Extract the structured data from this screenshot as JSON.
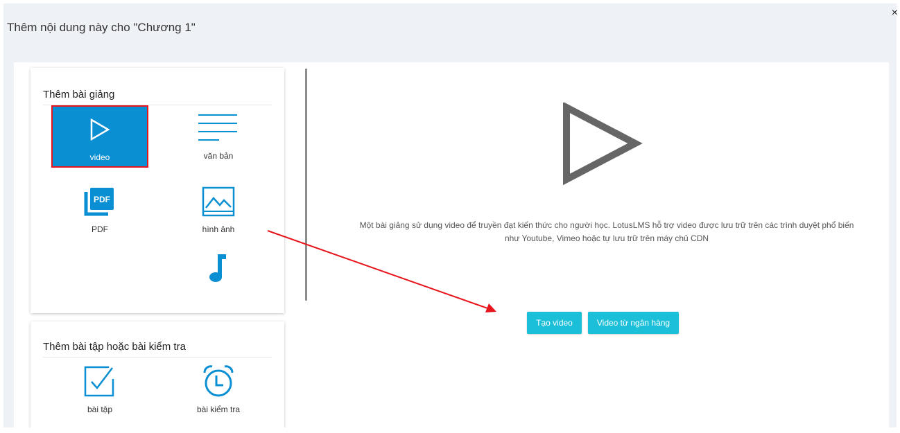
{
  "modal": {
    "title": "Thêm nội dung này cho \"Chương 1\"",
    "close_symbol": "×"
  },
  "lecture_section": {
    "heading": "Thêm bài giảng",
    "tiles": [
      {
        "label": "video",
        "icon": "play-icon",
        "selected": true
      },
      {
        "label": "văn bản",
        "icon": "text-lines-icon",
        "selected": false
      },
      {
        "label": "PDF",
        "icon": "pdf-icon",
        "selected": false
      },
      {
        "label": "hình ảnh",
        "icon": "image-icon",
        "selected": false
      },
      {
        "label": "",
        "icon": "music-note-icon",
        "selected": false
      }
    ],
    "pdf_icon_text": "PDF"
  },
  "exercise_section": {
    "heading": "Thêm bài tập hoặc bài kiểm tra",
    "tiles": [
      {
        "label": "bài tập",
        "icon": "checkbox-icon"
      },
      {
        "label": "bài kiểm tra",
        "icon": "alarm-clock-icon"
      }
    ]
  },
  "preview": {
    "icon": "play-outline-icon",
    "description_line1": "Một bài giảng sử dụng video để truyền đạt kiến thức cho người học. LotusLMS hỗ trợ video được lưu trữ trên các trình duyệt phổ biến",
    "description_line2": "như Youtube, Vimeo hoặc tự lưu trữ trên máy chủ CDN",
    "buttons": {
      "create": "Tạo video",
      "bank": "Video từ ngân hàng"
    }
  },
  "colors": {
    "accent_blue": "#0b8fd3",
    "button_cyan": "#1cbfd8",
    "highlight_red": "#e8141b",
    "annotation_arrow": "#e8141b"
  }
}
